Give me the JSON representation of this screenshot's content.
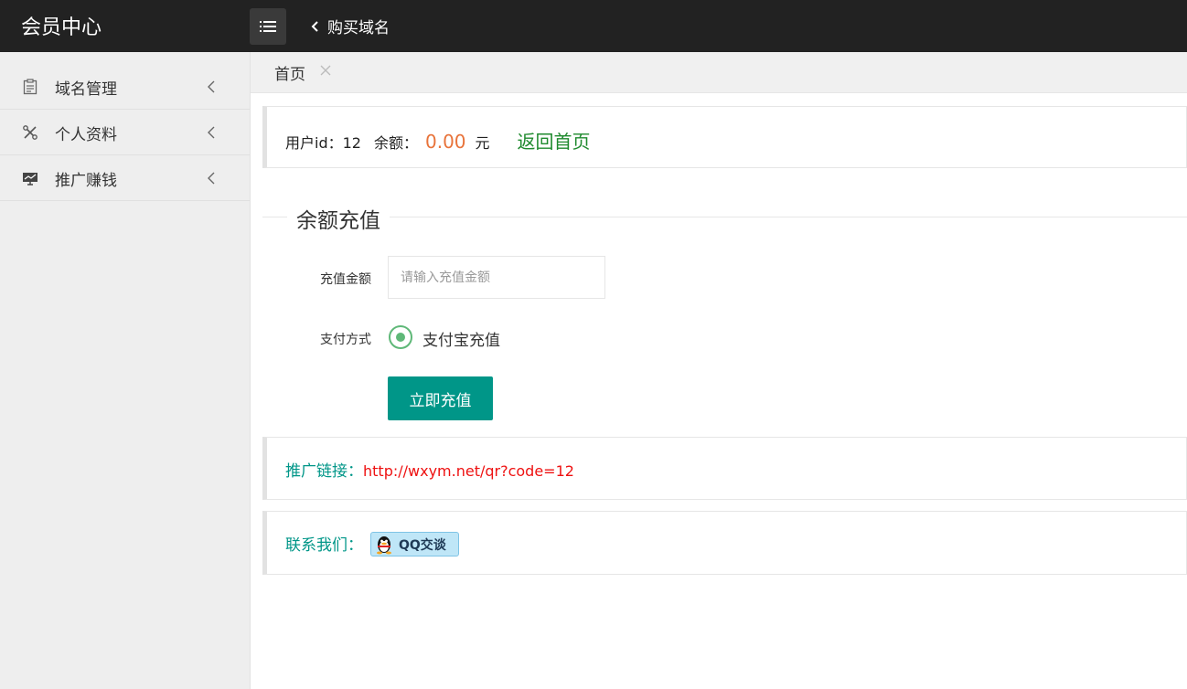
{
  "header": {
    "brand": "会员中心",
    "back_label": "购买域名"
  },
  "sidebar": {
    "items": [
      {
        "label": "域名管理",
        "icon": "clipboard-icon"
      },
      {
        "label": "个人资料",
        "icon": "tools-icon"
      },
      {
        "label": "推广赚钱",
        "icon": "monitor-chart-icon"
      }
    ]
  },
  "tabs": [
    {
      "label": "首页"
    }
  ],
  "account": {
    "user_label": "用户id：",
    "user_id": "12",
    "balance_label": "余额：",
    "balance": "0.00",
    "currency": "元",
    "home_link": "返回首页"
  },
  "recharge": {
    "title": "余额充值",
    "amount_label": "充值金额",
    "amount_placeholder": "请输入充值金额",
    "amount_value": "",
    "payment_label": "支付方式",
    "payment_option": "支付宝充值",
    "submit_label": "立即充值"
  },
  "promo": {
    "label": "推广链接：",
    "url": "http://wxym.net/qr?code=12"
  },
  "contact": {
    "label": "联系我们：",
    "qq_label": "QQ交谈"
  },
  "colors": {
    "topbar": "#222222",
    "sidebar": "#eeeeee",
    "accent": "#009688",
    "balance": "#e8733a",
    "link_green": "#1f8a2e",
    "url_red": "#ee1111"
  }
}
